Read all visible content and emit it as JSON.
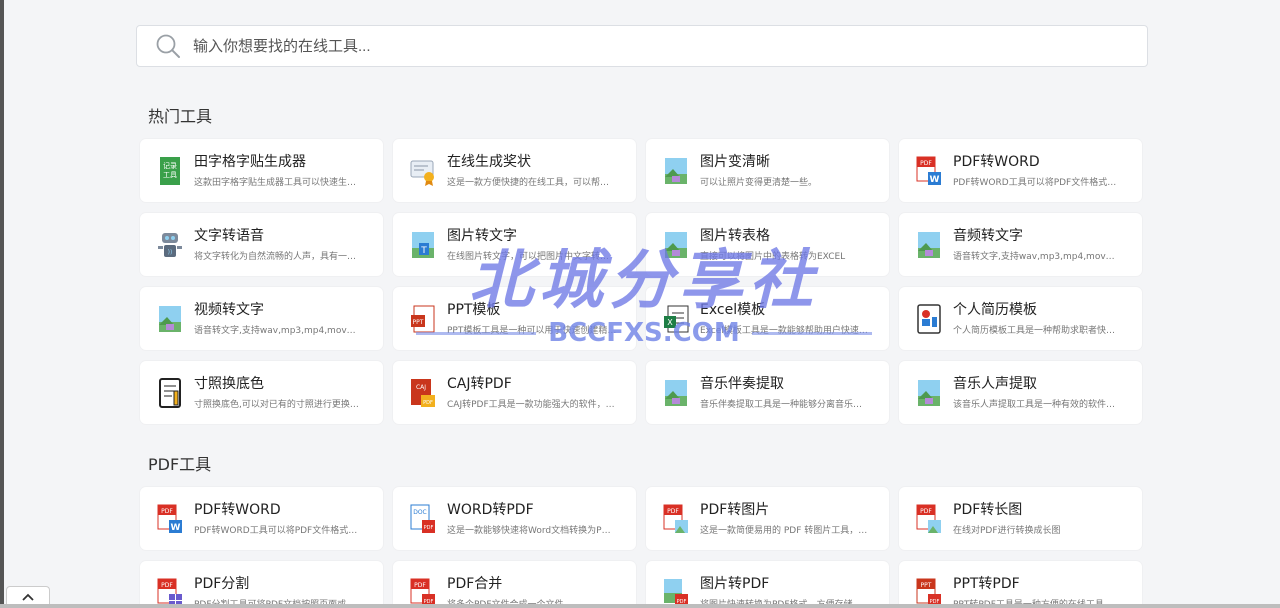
{
  "search": {
    "placeholder": "输入你想要找的在线工具..."
  },
  "sections": [
    {
      "title": "热门工具",
      "items": [
        {
          "title": "田字格字贴生成器",
          "desc": "这款田字格字贴生成器工具可以快速生成定...",
          "icon": "tianzige-icon"
        },
        {
          "title": "在线生成奖状",
          "desc": "这是一款方便快捷的在线工具，可以帮助您...",
          "icon": "certificate-icon"
        },
        {
          "title": "图片变清晰",
          "desc": "可以让照片变得更清楚一些。",
          "icon": "image-icon"
        },
        {
          "title": "PDF转WORD",
          "desc": "PDF转WORD工具可以将PDF文件格式转化...",
          "icon": "pdf-to-word-icon"
        },
        {
          "title": "文字转语音",
          "desc": "将文字转化为自然流畅的人声，具有一定的...",
          "icon": "robot-icon"
        },
        {
          "title": "图片转文字",
          "desc": "在线图片转文字，可以把图片中文字转文本...",
          "icon": "image-text-icon"
        },
        {
          "title": "图片转表格",
          "desc": "直接可以将图片中的表格转为EXCEL",
          "icon": "image-icon"
        },
        {
          "title": "音频转文字",
          "desc": "语音转文字,支持wav,mp3,mp4,mov格式中...",
          "icon": "image-icon"
        },
        {
          "title": "视频转文字",
          "desc": "语音转文字,支持wav,mp3,mp4,mov格式中...",
          "icon": "image-icon"
        },
        {
          "title": "PPT模板",
          "desc": "PPT模板工具是一种可以用于快速创建精美的演...",
          "icon": "ppt-icon"
        },
        {
          "title": "Excel模板",
          "desc": "Excel模板工具是一款能够帮助用户快速创建...",
          "icon": "excel-icon"
        },
        {
          "title": "个人简历模板",
          "desc": "个人简历模板工具是一种帮助求职者快速创...",
          "icon": "resume-icon"
        },
        {
          "title": "寸照换底色",
          "desc": "寸照换底色,可以对已有的寸照进行更换底色。",
          "icon": "notebook-icon"
        },
        {
          "title": "CAJ转PDF",
          "desc": "CAJ转PDF工具是一款功能强大的软件，可以...",
          "icon": "caj-icon"
        },
        {
          "title": "音乐伴奏提取",
          "desc": "音乐伴奏提取工具是一种能够分离音乐声和...",
          "icon": "image-icon"
        },
        {
          "title": "音乐人声提取",
          "desc": "该音乐人声提取工具是一种有效的软件，可...",
          "icon": "image-icon"
        }
      ]
    },
    {
      "title": "PDF工具",
      "items": [
        {
          "title": "PDF转WORD",
          "desc": "PDF转WORD工具可以将PDF文件格式转化...",
          "icon": "pdf-to-word-icon"
        },
        {
          "title": "WORD转PDF",
          "desc": "这是一款能够快速将Word文档转换为PDF格...",
          "icon": "doc-to-pdf-icon"
        },
        {
          "title": "PDF转图片",
          "desc": "这是一款简便易用的 PDF 转图片工具，能够...",
          "icon": "pdf-to-image-icon"
        },
        {
          "title": "PDF转长图",
          "desc": "在线对PDF进行转换成长图",
          "icon": "pdf-to-image-icon"
        },
        {
          "title": "PDF分割",
          "desc": "PDF分割工具可将PDF文档按照页面或书签分...",
          "icon": "pdf-split-icon"
        },
        {
          "title": "PDF合并",
          "desc": "将多个PDF文件合成一个文件",
          "icon": "pdf-merge-icon"
        },
        {
          "title": "图片转PDF",
          "desc": "将图片快速转换为PDF格式，方便存储和共...",
          "icon": "image-to-pdf-icon"
        },
        {
          "title": "PPT转PDF",
          "desc": "PPT转PDF工具是一种方便的在线工具，可以...",
          "icon": "ppt-to-pdf-icon"
        }
      ]
    }
  ],
  "watermark": {
    "main": "北城分享社",
    "sub": "BCCFXS.COM"
  },
  "colors": {
    "pdf_red": "#d93025",
    "word_blue": "#2b7cd3",
    "excel_green": "#1e7e45",
    "image_green": "#6ab36a",
    "image_sky": "#8fd0f0",
    "watermark": "#6e78e6"
  }
}
